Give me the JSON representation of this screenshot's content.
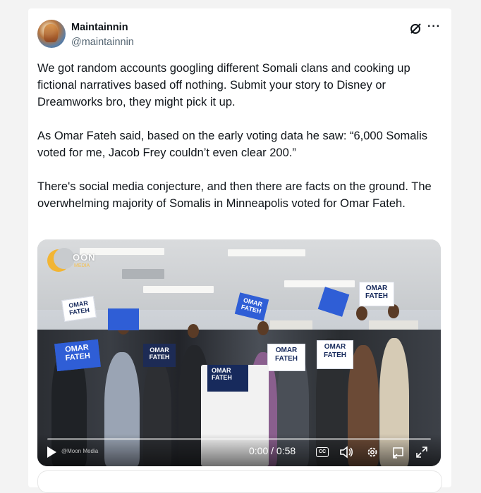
{
  "author": {
    "name": "Maintainnin",
    "handle": "@maintainnin"
  },
  "post": {
    "paragraphs": [
      "We got random accounts googling different Somali clans and cooking up fictional narratives based off nothing. Submit your story to Disney or Dreamworks bro, they might pick it up.",
      "As Omar Fateh said, based on the early voting data he saw: “6,000 Somalis voted for me, Jacob Frey couldn’t even clear 200.”",
      "There's social media conjecture, and then there are facts on the ground. The overwhelming majority of Somalis in Minneapolis voted for Omar Fateh."
    ]
  },
  "video": {
    "logo_text": "OON",
    "logo_sub": "MEDIA",
    "watermark": "@Moon Media",
    "sign_text_line1": "OMAR",
    "sign_text_line2": "FATEH",
    "podium_line1": "OMAR",
    "podium_line2": "FATEH",
    "current_time": "0:00",
    "separator": " / ",
    "duration": "0:58",
    "progress": 0
  },
  "icons": {
    "grok": "grok-slash-circle-icon",
    "more": "more-dots-icon",
    "play": "play-icon",
    "captions": "captions-icon",
    "volume": "volume-icon",
    "settings": "settings-gear-icon",
    "pip": "picture-in-picture-icon",
    "fullscreen": "fullscreen-icon"
  },
  "colors": {
    "text_primary": "#0f1419",
    "text_secondary": "#536471",
    "sign_navy": "#172a5c",
    "sign_blue": "#2f5ed6"
  }
}
